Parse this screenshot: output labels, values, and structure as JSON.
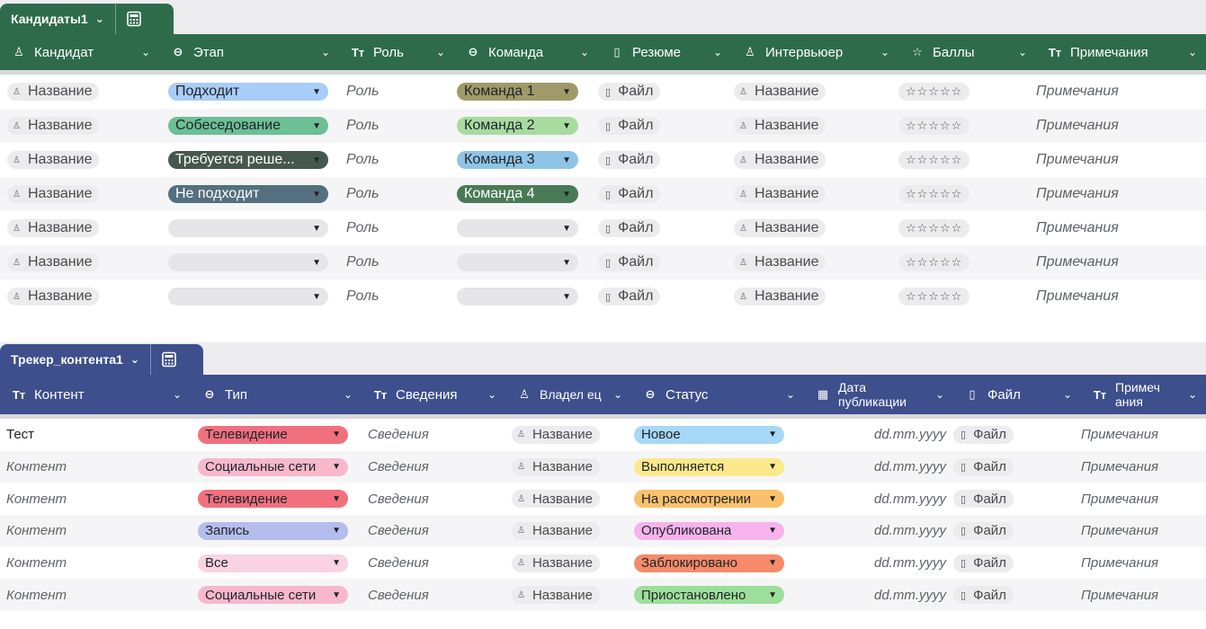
{
  "colors": {
    "candidates_header": "#2e6b4b",
    "tracker_header": "#3e4f8d"
  },
  "candidates": {
    "tab_name": "Кандидаты1",
    "columns": [
      {
        "icon": "person-icon",
        "glyph": "♙",
        "label": "Кандидат"
      },
      {
        "icon": "single-select-icon",
        "glyph": "⊖",
        "label": "Этап"
      },
      {
        "icon": "text-icon",
        "glyph": "Tт",
        "label": "Роль"
      },
      {
        "icon": "single-select-icon",
        "glyph": "⊖",
        "label": "Команда"
      },
      {
        "icon": "file-icon",
        "glyph": "▯",
        "label": "Резюме"
      },
      {
        "icon": "person-icon",
        "glyph": "♙",
        "label": "Интервьюер"
      },
      {
        "icon": "star-icon",
        "glyph": "☆",
        "label": "Баллы"
      },
      {
        "icon": "text-icon",
        "glyph": "Tт",
        "label": "Примечания"
      }
    ],
    "placeholders": {
      "name": "Название",
      "role": "Роль",
      "file": "Файл",
      "stars": "☆☆☆☆☆",
      "notes": "Примечания"
    },
    "rows": [
      {
        "stage": "Подходит",
        "stage_color": "#a8cdf7",
        "team": "Команда 1",
        "team_color": "#a09a6a"
      },
      {
        "stage": "Собеседование",
        "stage_color": "#6dbf95",
        "team": "Команда 2",
        "team_color": "#a8dba0"
      },
      {
        "stage": "Требуется реше...",
        "stage_color": "#46574e",
        "stage_text": "#ffffff",
        "team": "Команда 3",
        "team_color": "#8fc4e6"
      },
      {
        "stage": "Не подходит",
        "stage_color": "#54707f",
        "stage_text": "#ffffff",
        "team": "Команда 4",
        "team_color": "#4a7a55",
        "team_text": "#ffffff"
      },
      {
        "stage": "",
        "stage_color": "#e6e6e9",
        "team": "",
        "team_color": "#e6e6e9"
      },
      {
        "stage": "",
        "stage_color": "#e6e6e9",
        "team": "",
        "team_color": "#e6e6e9"
      },
      {
        "stage": "",
        "stage_color": "#e6e6e9",
        "team": "",
        "team_color": "#e6e6e9"
      }
    ]
  },
  "tracker": {
    "tab_name": "Трекер_контента1",
    "columns": [
      {
        "icon": "text-icon",
        "glyph": "Tт",
        "label": "Контент"
      },
      {
        "icon": "single-select-icon",
        "glyph": "⊖",
        "label": "Тип"
      },
      {
        "icon": "text-icon",
        "glyph": "Tт",
        "label": "Сведения"
      },
      {
        "icon": "person-icon",
        "glyph": "♙",
        "label": "Владел ец"
      },
      {
        "icon": "single-select-icon",
        "glyph": "⊖",
        "label": "Статус"
      },
      {
        "icon": "calendar-icon",
        "glyph": "▦",
        "label": "Дата публикации"
      },
      {
        "icon": "file-icon",
        "glyph": "▯",
        "label": "Файл"
      },
      {
        "icon": "text-icon",
        "glyph": "Tт",
        "label": "Примеч ания"
      }
    ],
    "placeholders": {
      "details": "Сведения",
      "name": "Название",
      "date": "dd.mm.yyyy",
      "file": "Файл",
      "notes": "Примечания"
    },
    "rows": [
      {
        "content": "Тест",
        "content_italic": false,
        "type": "Телевидение",
        "type_color": "#f0707e",
        "status": "Новое",
        "status_color": "#a6d8f7"
      },
      {
        "content": "Контент",
        "content_italic": true,
        "type": "Социальные сети",
        "type_color": "#f8b8cc",
        "status": "Выполняется",
        "status_color": "#fbe98c"
      },
      {
        "content": "Контент",
        "content_italic": true,
        "type": "Телевидение",
        "type_color": "#f0707e",
        "status": "На рассмотрении",
        "status_color": "#fbc06b"
      },
      {
        "content": "Контент",
        "content_italic": true,
        "type": "Запись",
        "type_color": "#b4bdee",
        "status": "Опубликована",
        "status_color": "#f6b3ec"
      },
      {
        "content": "Контент",
        "content_italic": true,
        "type": "Все",
        "type_color": "#f9d3e2",
        "status": "Заблокировано",
        "status_color": "#f58b6b"
      },
      {
        "content": "Контент",
        "content_italic": true,
        "type": "Социальные сети",
        "type_color": "#f8b8cc",
        "status": "Приостановлено",
        "status_color": "#9cdf9a"
      }
    ]
  }
}
